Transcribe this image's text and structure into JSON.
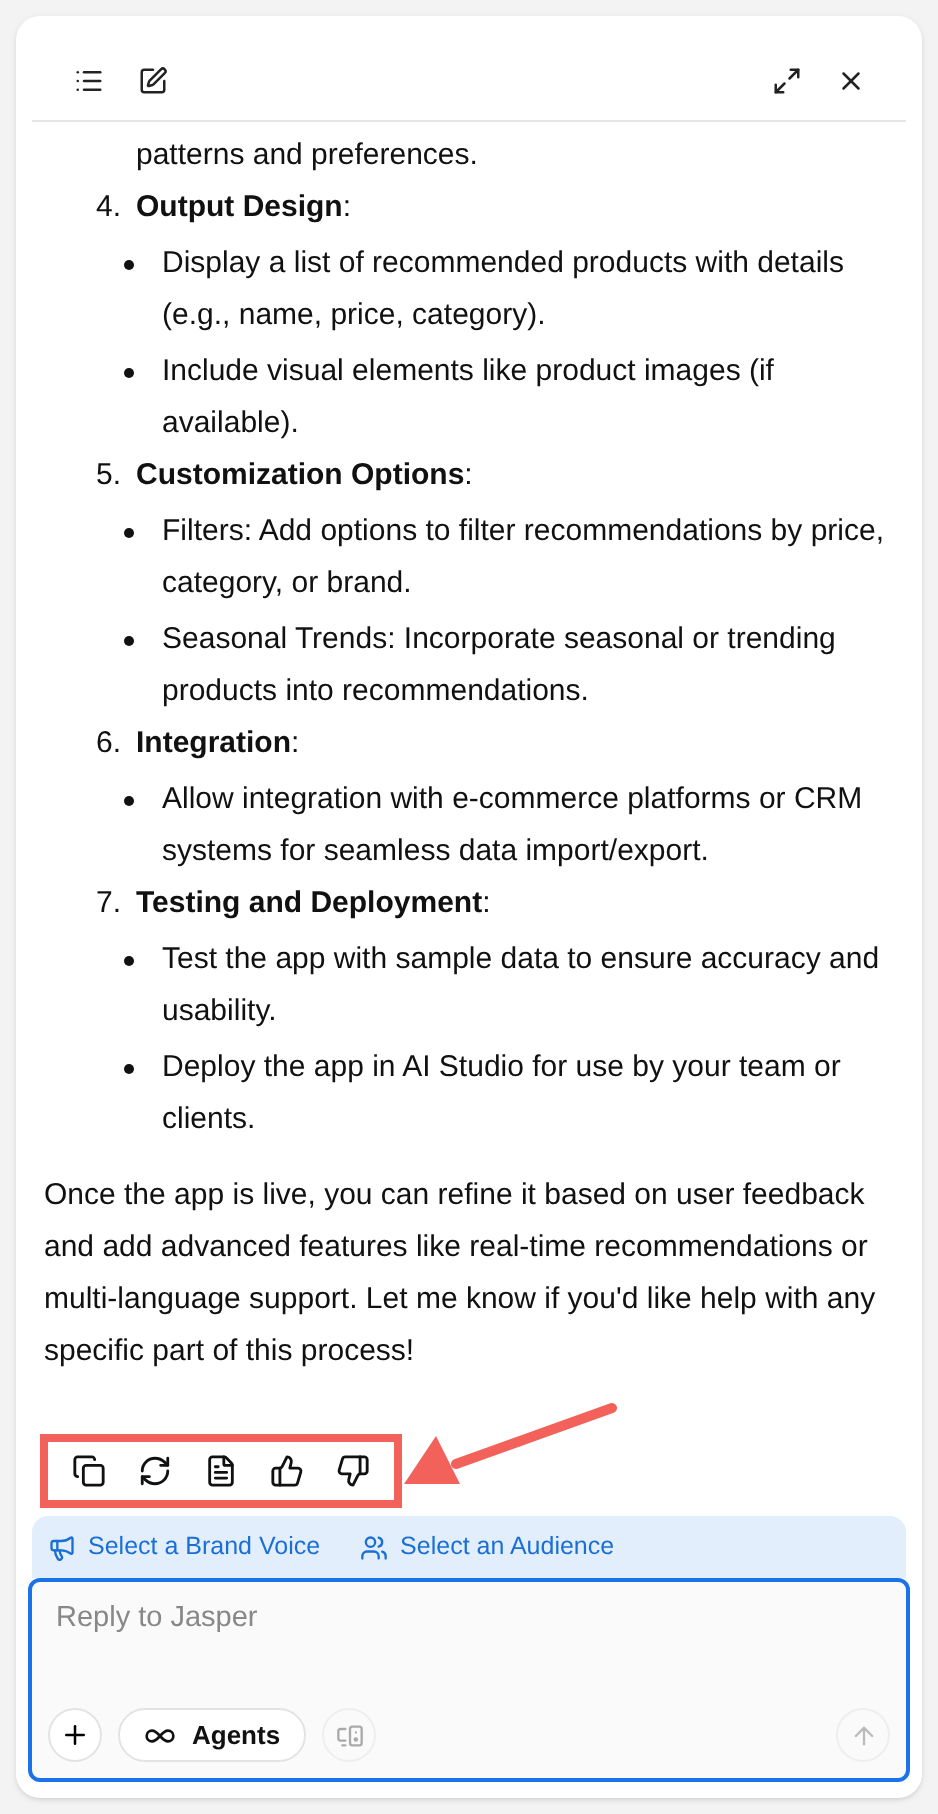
{
  "message": {
    "continued_text": "patterns and preferences.",
    "steps": [
      {
        "number": "4.",
        "title": "Output Design",
        "suffix": ":",
        "bullets": [
          "Display a list of recommended products with details (e.g., name, price, category).",
          "Include visual elements like product images (if available)."
        ]
      },
      {
        "number": "5.",
        "title": "Customization Options",
        "suffix": ":",
        "bullets": [
          "Filters: Add options to filter recommendations by price, category, or brand.",
          "Seasonal Trends: Incorporate seasonal or trending products into recommendations."
        ]
      },
      {
        "number": "6.",
        "title": "Integration",
        "suffix": ":",
        "bullets": [
          "Allow integration with e-commerce platforms or CRM systems for seamless data import/export."
        ]
      },
      {
        "number": "7.",
        "title": "Testing and Deployment",
        "suffix": ":",
        "bullets": [
          "Test the app with sample data to ensure accuracy and usability.",
          "Deploy the app in AI Studio for use by your team or clients."
        ]
      }
    ],
    "closing": "Once the app is live, you can refine it based on user feedback and add advanced features like real-time recommendations or multi-language support. Let me know if you'd like help with any specific part of this process!"
  },
  "annotation": {
    "highlighted": true
  },
  "context_bar": [
    {
      "kind": "brand",
      "label": "Select a Brand Voice"
    },
    {
      "kind": "audience",
      "label": "Select an Audience"
    }
  ],
  "composer": {
    "placeholder": "Reply to Jasper",
    "agents_label": "Agents"
  }
}
